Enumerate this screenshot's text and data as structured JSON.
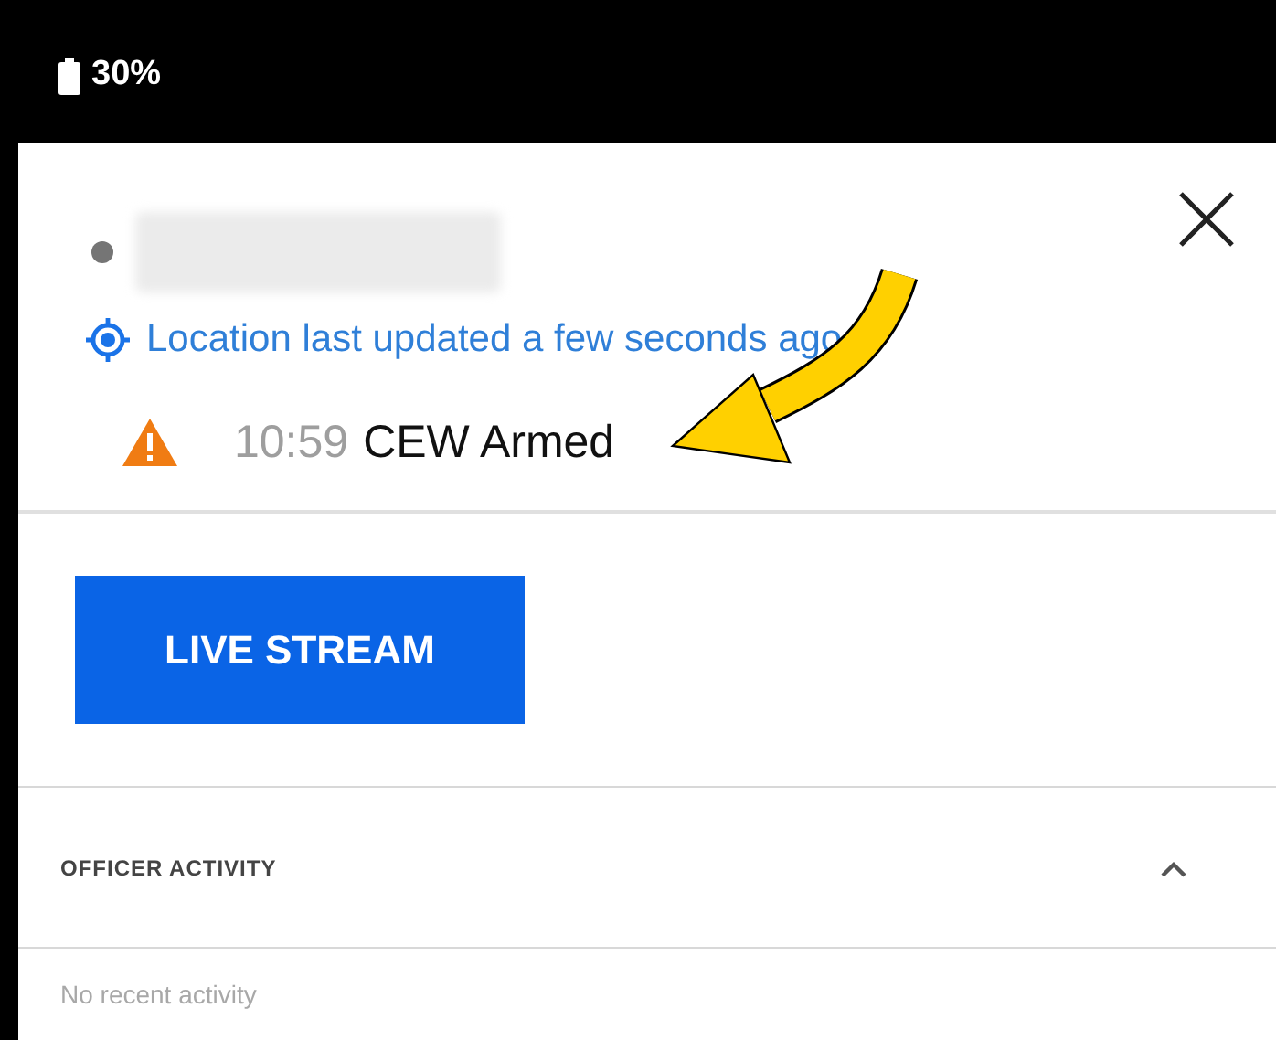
{
  "status_bar": {
    "battery": "30%"
  },
  "officer": {
    "color": "#757575",
    "name_blurred": true
  },
  "location": {
    "text": "Location last updated a few seconds ago"
  },
  "event": {
    "time": "10:59",
    "label": "CEW Armed"
  },
  "live_stream_button": "LIVE STREAM",
  "activity": {
    "title": "OFFICER ACTIVITY",
    "expanded": true,
    "empty_text": "No recent activity"
  }
}
